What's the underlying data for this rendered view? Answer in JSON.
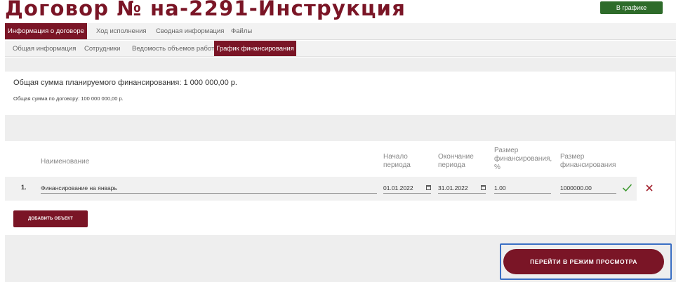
{
  "header": {
    "title": "Договор № на-2291-Инструкция",
    "status_label": "В графике"
  },
  "tabs_main": [
    {
      "label": "Информация о договоре",
      "active": true
    },
    {
      "label": "Ход исполнения",
      "active": false
    },
    {
      "label": "Сводная информация",
      "active": false
    },
    {
      "label": "Файлы",
      "active": false
    }
  ],
  "tabs_sub": [
    {
      "label": "Общая информация",
      "active": false
    },
    {
      "label": "Сотрудники",
      "active": false
    },
    {
      "label": "Ведомость объемов работ",
      "active": false
    },
    {
      "label": "График финансирования",
      "active": true
    }
  ],
  "summary": {
    "planned_total": "Общая сумма планируемого финансирования: 1 000 000,00 р.",
    "contract_total": "Общая сумма по договору: 100 000 000,00 р."
  },
  "table": {
    "headers": {
      "name": "Наименование",
      "start": [
        "Начало",
        "периода"
      ],
      "end": [
        "Окончание",
        "периода"
      ],
      "percent": [
        "Размер",
        "финансирования,",
        "%"
      ],
      "amount": [
        "Размер",
        "финансирования"
      ]
    },
    "rows": [
      {
        "num": "1.",
        "name": "Финансирование на январь",
        "start": "01.01.2022",
        "end": "31.01.2022",
        "percent": "1.00",
        "amount": "1000000.00"
      }
    ],
    "add_label": "ДОБАВИТЬ ОБЪЕКТ"
  },
  "actions": {
    "view_mode_label": "ПЕРЕЙТИ В РЕЖИМ ПРОСМОТРА"
  },
  "icons": {
    "confirm": "check-icon",
    "remove": "close-icon",
    "calendar": "calendar-icon"
  },
  "colors": {
    "brand": "#7a1526",
    "status": "#2e6b2a",
    "confirm": "#3f9a31",
    "remove": "#a3222f",
    "highlight": "#3a6fc4"
  }
}
